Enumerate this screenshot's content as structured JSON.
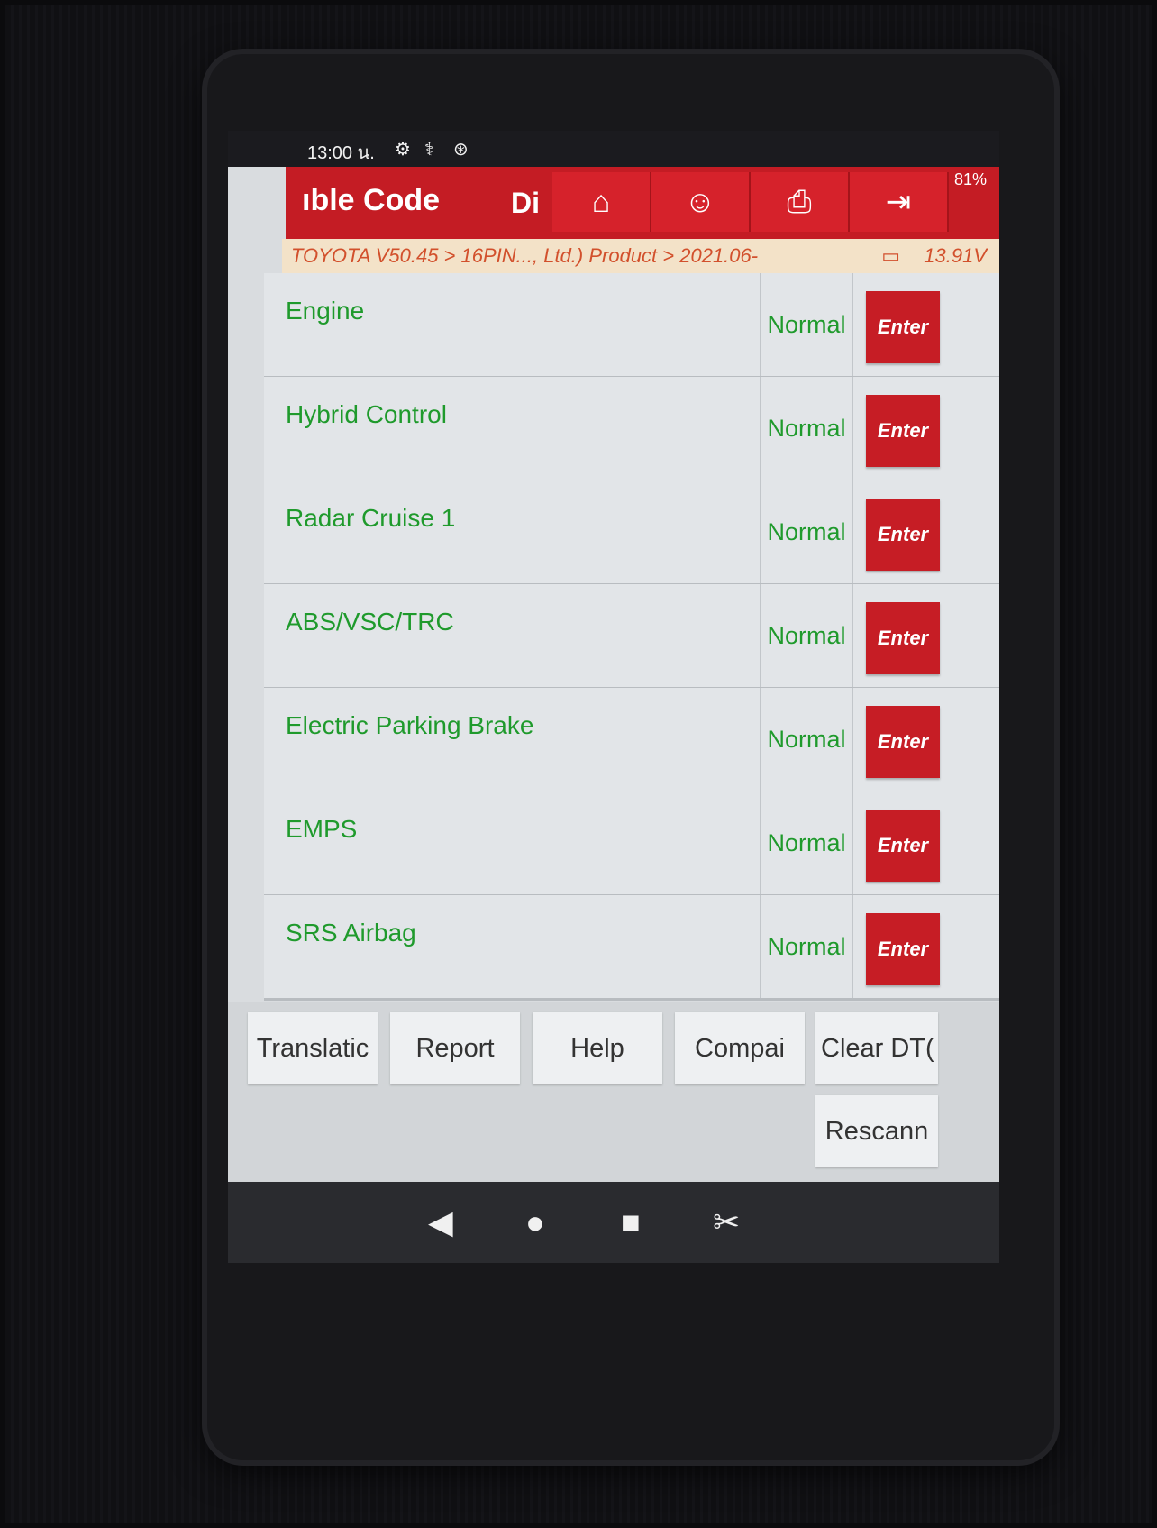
{
  "status_bar": {
    "time": "13:00 น.",
    "battery": "81%"
  },
  "header": {
    "title": "ıble Code",
    "title_extra": "Di",
    "nav": [
      "home-icon",
      "user-support-icon",
      "print-icon",
      "exit-icon"
    ]
  },
  "breadcrumb": {
    "path": "TOYOTA V50.45 > 16PIN..., Ltd.) Product > 2021.06-",
    "voltage": "13.91V"
  },
  "systems": [
    {
      "name": "Engine",
      "status": "Normal",
      "action": "Enter"
    },
    {
      "name": "Hybrid Control",
      "status": "Normal",
      "action": "Enter"
    },
    {
      "name": "Radar Cruise 1",
      "status": "Normal",
      "action": "Enter"
    },
    {
      "name": "ABS/VSC/TRC",
      "status": "Normal",
      "action": "Enter"
    },
    {
      "name": "Electric Parking Brake",
      "status": "Normal",
      "action": "Enter"
    },
    {
      "name": "EMPS",
      "status": "Normal",
      "action": "Enter"
    },
    {
      "name": "SRS Airbag",
      "status": "Normal",
      "action": "Enter"
    }
  ],
  "toolbar": {
    "translation": "Translatic",
    "report": "Report",
    "help": "Help",
    "compare": "Compai",
    "clear_dtc": "Clear DT(",
    "rescan": "Rescann"
  },
  "colors": {
    "header_red": "#c41c24",
    "status_green": "#1f9a2c",
    "breadcrumb_orange": "#d2502c"
  }
}
